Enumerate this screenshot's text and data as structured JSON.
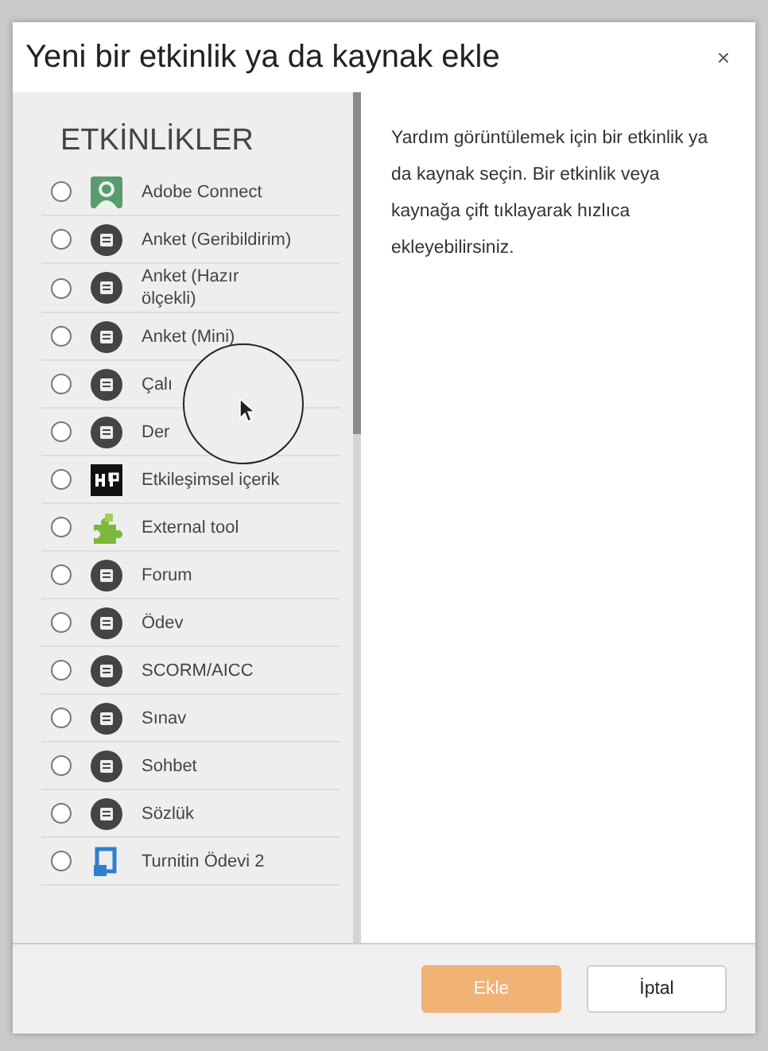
{
  "dialog": {
    "title": "Yeni bir etkinlik ya da kaynak ekle",
    "close": "×"
  },
  "sidebar": {
    "heading": "ETKİNLİKLER",
    "items": [
      {
        "label": "Adobe Connect",
        "kind": "green-tile",
        "selected": false
      },
      {
        "label": "Anket (Geribildirim)",
        "kind": "round",
        "selected": false
      },
      {
        "label": "Anket (Hazır ölçekli)",
        "kind": "round",
        "selected": false
      },
      {
        "label": "Anket (Mini)",
        "kind": "round",
        "selected": false
      },
      {
        "label": "Çalı",
        "kind": "round",
        "selected": false
      },
      {
        "label": "Der",
        "kind": "round",
        "selected": false
      },
      {
        "label": "Etkileşimsel içerik",
        "kind": "black-tile",
        "selected": false
      },
      {
        "label": "External tool",
        "kind": "puzzle",
        "selected": false
      },
      {
        "label": "Forum",
        "kind": "round",
        "selected": false
      },
      {
        "label": "Ödev",
        "kind": "round",
        "selected": false
      },
      {
        "label": "SCORM/AICC",
        "kind": "round",
        "selected": false
      },
      {
        "label": "Sınav",
        "kind": "round",
        "selected": false
      },
      {
        "label": "Sohbet",
        "kind": "round",
        "selected": false
      },
      {
        "label": "Sözlük",
        "kind": "round",
        "selected": false
      },
      {
        "label": "Turnitin Ödevi 2",
        "kind": "blue-tile",
        "selected": false
      }
    ]
  },
  "help": {
    "text": "Yardım görüntülemek için bir etkinlik ya da kaynak seçin. Bir etkinlik veya kaynağa çift tıklayarak hızlıca ekleyebilirsiniz."
  },
  "buttons": [
    {
      "label": "Ekle",
      "kind": "primary",
      "disabled": true
    },
    {
      "label": "İptal",
      "kind": "secondary",
      "disabled": false
    }
  ]
}
